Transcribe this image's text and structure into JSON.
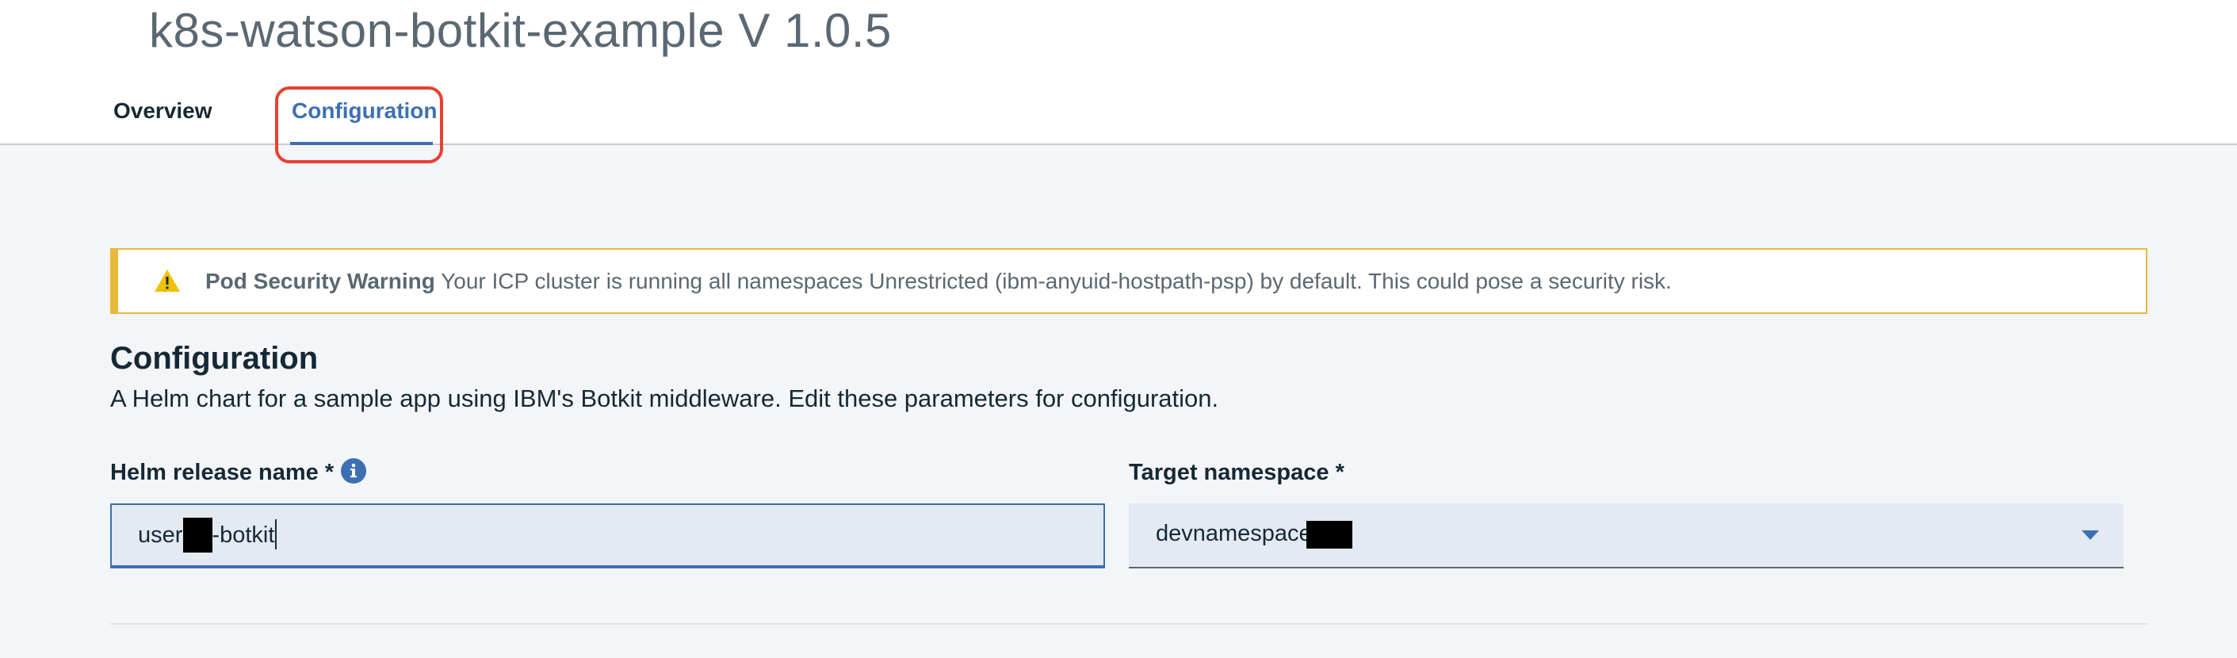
{
  "header": {
    "title": "k8s-watson-botkit-example V 1.0.5",
    "tabs": [
      {
        "label": "Overview",
        "active": false
      },
      {
        "label": "Configuration",
        "active": true
      }
    ]
  },
  "warning": {
    "icon": "warning-triangle-icon",
    "title": "Pod Security Warning",
    "message": "Your ICP cluster is running all namespaces Unrestricted (ibm-anyuid-hostpath-psp) by default. This could pose a security risk."
  },
  "configuration": {
    "title": "Configuration",
    "description": "A Helm chart for a sample app using IBM's Botkit middleware. Edit these parameters for configuration.",
    "helm_release": {
      "label": "Helm release name *",
      "value_prefix": "user",
      "value_suffix": "-botkit"
    },
    "target_namespace": {
      "label": "Target namespace *",
      "value": "devnamespace"
    }
  },
  "colors": {
    "accent": "#3d70b2",
    "warning": "#e9b93b",
    "highlight": "#e8402f"
  }
}
